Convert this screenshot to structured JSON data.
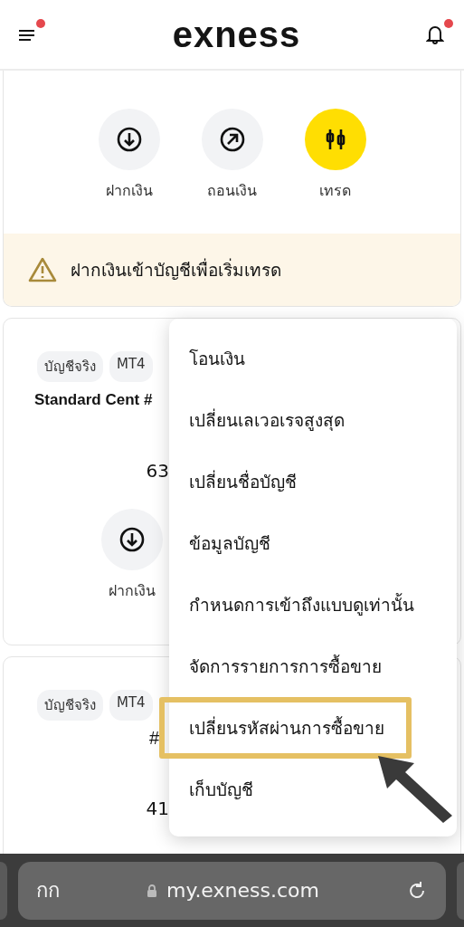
{
  "header": {
    "logo": "exness",
    "menu_badge": true,
    "bell_badge": true
  },
  "actions": [
    {
      "kind": "deposit",
      "label": "ฝากเงิน"
    },
    {
      "kind": "withdraw",
      "label": "ถอนเงิน"
    },
    {
      "kind": "trade",
      "label": "เทรด"
    }
  ],
  "warning": "ฝากเงินเข้าบัญชีเพื่อเริ่มเทรด",
  "accounts": [
    {
      "tags": [
        "บัญชีจริง",
        "MT4"
      ],
      "title": "Standard Cent #",
      "balance": "63",
      "actions": [
        {
          "kind": "deposit",
          "label": "ฝากเงิน"
        }
      ]
    },
    {
      "tags": [
        "บัญชีจริง",
        "MT4"
      ],
      "title": "#",
      "balance": "41"
    }
  ],
  "menu": [
    {
      "label": "โอนเงิน",
      "highlighted": false
    },
    {
      "label": "เปลี่ยนเลเวอเรจสูงสุด",
      "highlighted": false
    },
    {
      "label": "เปลี่ยนชื่อบัญชี",
      "highlighted": false
    },
    {
      "label": "ข้อมูลบัญชี",
      "highlighted": false
    },
    {
      "label": "กำหนดการเข้าถึงแบบดูเท่านั้น",
      "highlighted": false
    },
    {
      "label": "จัดการรายการการซื้อขาย",
      "highlighted": false
    },
    {
      "label": "เปลี่ยนรหัสผ่านการซื้อขาย",
      "highlighted": true
    },
    {
      "label": "เก็บบัญชี",
      "highlighted": false
    }
  ],
  "browser": {
    "text_size": "กก",
    "url": "my.exness.com"
  }
}
